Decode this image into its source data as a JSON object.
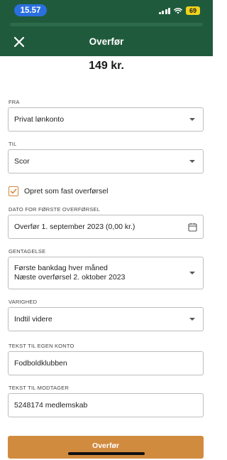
{
  "status_bar": {
    "time": "15.57",
    "battery": "69"
  },
  "header": {
    "title": "Overfør",
    "close_icon": "close-icon"
  },
  "amount": "149 kr.",
  "form": {
    "from": {
      "label": "FRA",
      "value": "Privat lønkonto"
    },
    "to": {
      "label": "TIL",
      "value": "Scor"
    },
    "recurring_checkbox": {
      "label": "Opret som fast overførsel",
      "checked": true
    },
    "first_transfer_date": {
      "label": "DATO FOR FØRSTE OVERFØRSEL",
      "value": "Overfør 1. september 2023 (0,00 kr.)",
      "icon": "calendar-icon"
    },
    "repetition": {
      "label": "GENTAGELSE",
      "line1": "Første bankdag hver måned",
      "line2": "Næste overførsel 2. oktober 2023"
    },
    "duration": {
      "label": "VARIGHED",
      "value": "Indtil videre"
    },
    "own_text": {
      "label": "TEKST TIL EGEN KONTO",
      "value": "Fodboldklubben"
    },
    "recipient_text": {
      "label": "TEKST TIL MODTAGER",
      "value": "5248174 medlemskab"
    }
  },
  "submit_button": {
    "label": "Overfør"
  },
  "colors": {
    "header_green": "#1f5a3c",
    "accent_orange": "#d18b3f",
    "time_pill_blue": "#2a6fe0",
    "battery_yellow": "#f0d21b"
  }
}
